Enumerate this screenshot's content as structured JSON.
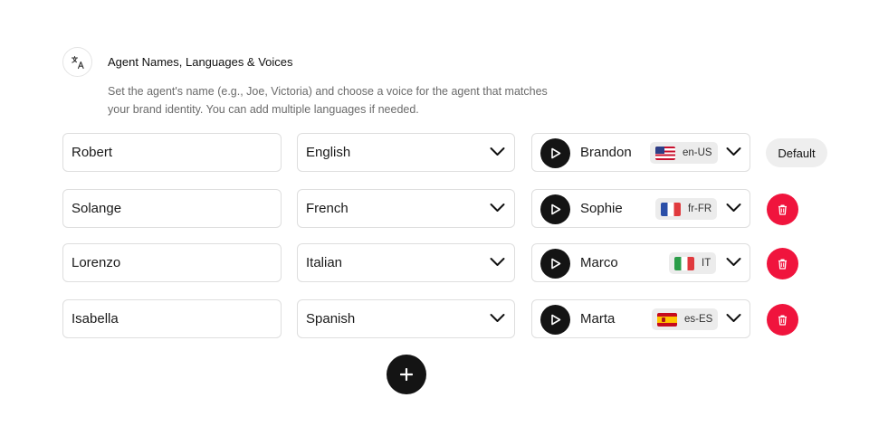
{
  "section": {
    "title": "Agent Names, Languages & Voices",
    "description": "Set the agent's name (e.g., Joe, Victoria) and choose a voice for the agent that matches your brand identity. You can add multiple languages if needed.",
    "icon": "translate-icon"
  },
  "agents": [
    {
      "name": "Robert",
      "language": "English",
      "voice": "Brandon",
      "locale": "en-US",
      "flag": "us-flag-icon",
      "action": "Default"
    },
    {
      "name": "Solange",
      "language": "French",
      "voice": "Sophie",
      "locale": "fr-FR",
      "flag": "france-flag-icon",
      "action": "delete"
    },
    {
      "name": "Lorenzo",
      "language": "Italian",
      "voice": "Marco",
      "locale": "IT",
      "flag": "italy-flag-icon",
      "action": "delete"
    },
    {
      "name": "Isabella",
      "language": "Spanish",
      "voice": "Marta",
      "locale": "es-ES",
      "flag": "spain-flag-icon",
      "action": "delete"
    }
  ],
  "colors": {
    "delete": "#f0143d",
    "dark": "#141414",
    "badge": "#ececec"
  }
}
